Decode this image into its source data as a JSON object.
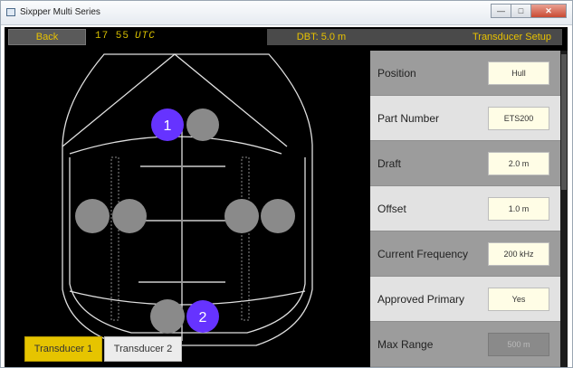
{
  "window": {
    "title": "Sixpper Multi Series",
    "buttons": {
      "minimize": "—",
      "maximize": "□",
      "close": "✕"
    }
  },
  "topbar": {
    "back_label": "Back",
    "time": "17  55",
    "time_zone": "UTC",
    "dbt": "DBT: 5.0 m",
    "screen_title": "Transducer Setup"
  },
  "diagram": {
    "markers": [
      {
        "number": "1",
        "color": "#6633ff"
      },
      {
        "number": "2",
        "color": "#6633ff"
      }
    ],
    "transducer_color": "#8a8a8a"
  },
  "tabs": [
    {
      "label": "Transducer 1",
      "active": true
    },
    {
      "label": "Transducer 2",
      "active": false
    }
  ],
  "settings": [
    {
      "label": "Position",
      "value": "Hull",
      "enabled": true
    },
    {
      "label": "Part Number",
      "value": "ETS200",
      "enabled": true
    },
    {
      "label": "Draft",
      "value": "2.0 m",
      "enabled": true
    },
    {
      "label": "Offset",
      "value": "1.0 m",
      "enabled": true
    },
    {
      "label": "Current Frequency",
      "value": "200 kHz",
      "enabled": true
    },
    {
      "label": "Approved Primary",
      "value": "Yes",
      "enabled": true
    },
    {
      "label": "Max Range",
      "value": "500 m",
      "enabled": false
    }
  ]
}
